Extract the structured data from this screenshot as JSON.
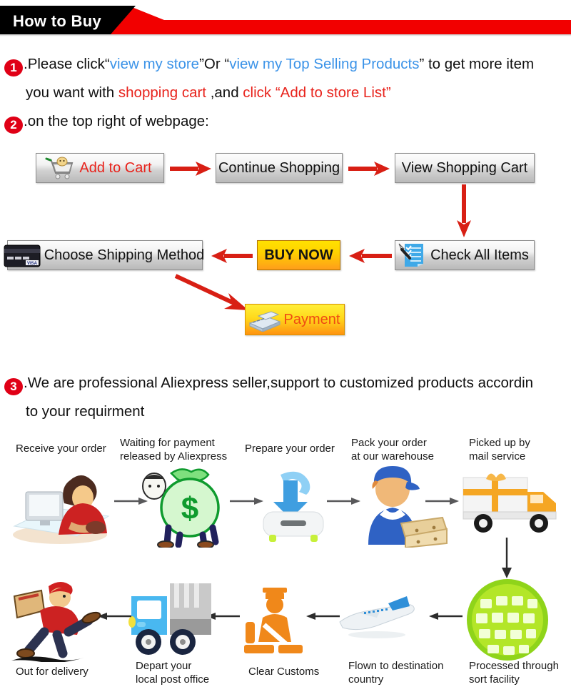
{
  "header": {
    "title": "How to Buy",
    "black_color": "#000000",
    "red_color": "#f20000"
  },
  "steps": {
    "step1": {
      "number": "1",
      "t1": ".Please click“",
      "link1": "view my store",
      "t2": "”Or “",
      "link2": "view my Top Selling Products",
      "t3": "” to get more item",
      "line2_t1": "you want with ",
      "line2_red1": "shopping cart",
      "line2_t2": " ,and ",
      "line2_red2": "click “Add to store List”"
    },
    "step2": {
      "number": "2",
      "text": ".on the top right of webpage:"
    },
    "step3": {
      "number": "3",
      "text": ".We are professional Aliexpress seller,support to customized products accordin",
      "line2": "to your requirment"
    }
  },
  "flow": {
    "add_to_cart": "Add to Cart",
    "continue_shopping": "Continue Shopping",
    "view_shopping_cart": "View Shopping Cart",
    "choose_shipping_method": "Choose Shipping Method",
    "buy_now": "BUY NOW",
    "check_all_items": "Check All Items",
    "payment": "Payment",
    "arrow_color": "#d81f14",
    "orange_color": "#ffd000"
  },
  "process": {
    "row1": [
      {
        "label": "Receive your order",
        "icon": "person-at-computer-icon"
      },
      {
        "label": "Waiting for payment\nreleased by Aliexpress",
        "icon": "money-bag-icon"
      },
      {
        "label": "Prepare your order",
        "icon": "download-box-icon"
      },
      {
        "label": "Pack your order\nat our warehouse",
        "icon": "warehouse-worker-icon"
      },
      {
        "label": "Picked up by\nmail service",
        "icon": "delivery-truck-gift-icon"
      }
    ],
    "row2": [
      {
        "label": "Out for delivery",
        "icon": "running-courier-icon"
      },
      {
        "label": "Depart your\nlocal post office",
        "icon": "blue-post-truck-icon"
      },
      {
        "label": "Clear Customs",
        "icon": "customs-officer-icon"
      },
      {
        "label": "Flown to destination\ncountry",
        "icon": "airplane-icon"
      },
      {
        "label": "Processed through\nsort facility",
        "icon": "green-globe-icon"
      }
    ]
  }
}
